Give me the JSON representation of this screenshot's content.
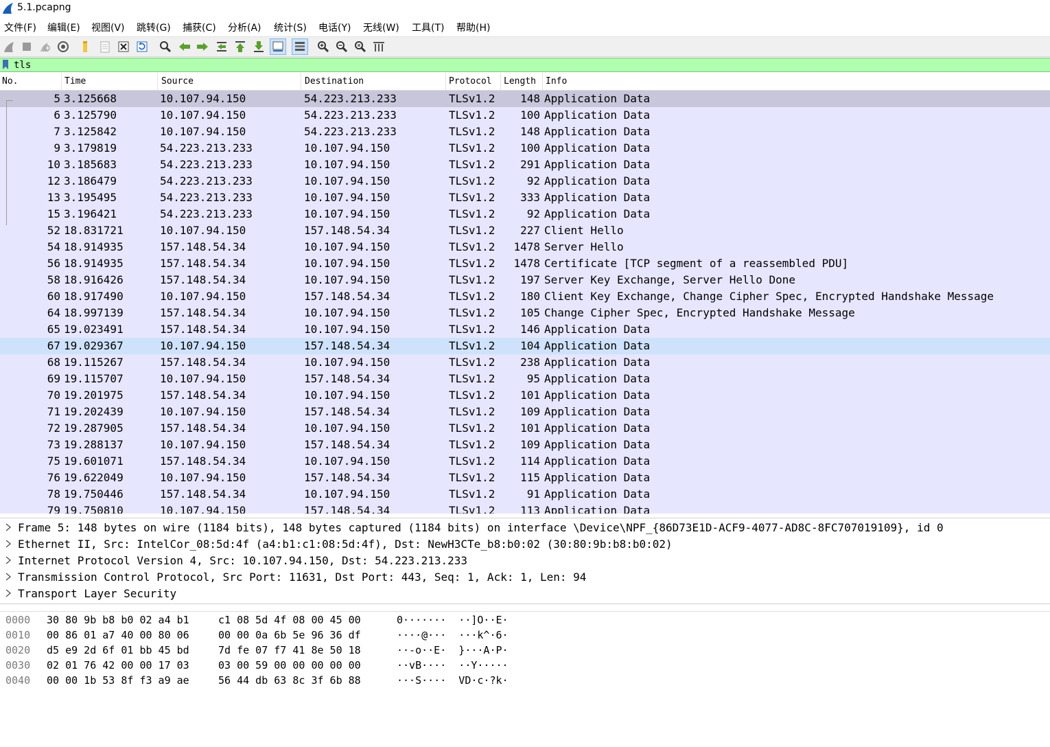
{
  "window": {
    "title": "5.1.pcapng"
  },
  "menu": [
    "文件(F)",
    "编辑(E)",
    "视图(V)",
    "跳转(G)",
    "捕获(C)",
    "分析(A)",
    "统计(S)",
    "电话(Y)",
    "无线(W)",
    "工具(T)",
    "帮助(H)"
  ],
  "filter": {
    "value": "tls"
  },
  "columns": {
    "no": "No.",
    "time": "Time",
    "source": "Source",
    "destination": "Destination",
    "protocol": "Protocol",
    "length": "Length",
    "info": "Info"
  },
  "packets": [
    {
      "no": "5",
      "time": "3.125668",
      "src": "10.107.94.150",
      "dst": "54.223.213.233",
      "proto": "TLSv1.2",
      "len": "148",
      "info": "Application Data"
    },
    {
      "no": "6",
      "time": "3.125790",
      "src": "10.107.94.150",
      "dst": "54.223.213.233",
      "proto": "TLSv1.2",
      "len": "100",
      "info": "Application Data"
    },
    {
      "no": "7",
      "time": "3.125842",
      "src": "10.107.94.150",
      "dst": "54.223.213.233",
      "proto": "TLSv1.2",
      "len": "148",
      "info": "Application Data"
    },
    {
      "no": "9",
      "time": "3.179819",
      "src": "54.223.213.233",
      "dst": "10.107.94.150",
      "proto": "TLSv1.2",
      "len": "100",
      "info": "Application Data"
    },
    {
      "no": "10",
      "time": "3.185683",
      "src": "54.223.213.233",
      "dst": "10.107.94.150",
      "proto": "TLSv1.2",
      "len": "291",
      "info": "Application Data"
    },
    {
      "no": "12",
      "time": "3.186479",
      "src": "54.223.213.233",
      "dst": "10.107.94.150",
      "proto": "TLSv1.2",
      "len": "92",
      "info": "Application Data"
    },
    {
      "no": "13",
      "time": "3.195495",
      "src": "54.223.213.233",
      "dst": "10.107.94.150",
      "proto": "TLSv1.2",
      "len": "333",
      "info": "Application Data"
    },
    {
      "no": "15",
      "time": "3.196421",
      "src": "54.223.213.233",
      "dst": "10.107.94.150",
      "proto": "TLSv1.2",
      "len": "92",
      "info": "Application Data"
    },
    {
      "no": "52",
      "time": "18.831721",
      "src": "10.107.94.150",
      "dst": "157.148.54.34",
      "proto": "TLSv1.2",
      "len": "227",
      "info": "Client Hello"
    },
    {
      "no": "54",
      "time": "18.914935",
      "src": "157.148.54.34",
      "dst": "10.107.94.150",
      "proto": "TLSv1.2",
      "len": "1478",
      "info": "Server Hello"
    },
    {
      "no": "56",
      "time": "18.914935",
      "src": "157.148.54.34",
      "dst": "10.107.94.150",
      "proto": "TLSv1.2",
      "len": "1478",
      "info": "Certificate [TCP segment of a reassembled PDU]"
    },
    {
      "no": "58",
      "time": "18.916426",
      "src": "157.148.54.34",
      "dst": "10.107.94.150",
      "proto": "TLSv1.2",
      "len": "197",
      "info": "Server Key Exchange, Server Hello Done"
    },
    {
      "no": "60",
      "time": "18.917490",
      "src": "10.107.94.150",
      "dst": "157.148.54.34",
      "proto": "TLSv1.2",
      "len": "180",
      "info": "Client Key Exchange, Change Cipher Spec, Encrypted Handshake Message"
    },
    {
      "no": "64",
      "time": "18.997139",
      "src": "157.148.54.34",
      "dst": "10.107.94.150",
      "proto": "TLSv1.2",
      "len": "105",
      "info": "Change Cipher Spec, Encrypted Handshake Message"
    },
    {
      "no": "65",
      "time": "19.023491",
      "src": "157.148.54.34",
      "dst": "10.107.94.150",
      "proto": "TLSv1.2",
      "len": "146",
      "info": "Application Data"
    },
    {
      "no": "67",
      "time": "19.029367",
      "src": "10.107.94.150",
      "dst": "157.148.54.34",
      "proto": "TLSv1.2",
      "len": "104",
      "info": "Application Data"
    },
    {
      "no": "68",
      "time": "19.115267",
      "src": "157.148.54.34",
      "dst": "10.107.94.150",
      "proto": "TLSv1.2",
      "len": "238",
      "info": "Application Data"
    },
    {
      "no": "69",
      "time": "19.115707",
      "src": "10.107.94.150",
      "dst": "157.148.54.34",
      "proto": "TLSv1.2",
      "len": "95",
      "info": "Application Data"
    },
    {
      "no": "70",
      "time": "19.201975",
      "src": "157.148.54.34",
      "dst": "10.107.94.150",
      "proto": "TLSv1.2",
      "len": "101",
      "info": "Application Data"
    },
    {
      "no": "71",
      "time": "19.202439",
      "src": "10.107.94.150",
      "dst": "157.148.54.34",
      "proto": "TLSv1.2",
      "len": "109",
      "info": "Application Data"
    },
    {
      "no": "72",
      "time": "19.287905",
      "src": "157.148.54.34",
      "dst": "10.107.94.150",
      "proto": "TLSv1.2",
      "len": "101",
      "info": "Application Data"
    },
    {
      "no": "73",
      "time": "19.288137",
      "src": "10.107.94.150",
      "dst": "157.148.54.34",
      "proto": "TLSv1.2",
      "len": "109",
      "info": "Application Data"
    },
    {
      "no": "75",
      "time": "19.601071",
      "src": "157.148.54.34",
      "dst": "10.107.94.150",
      "proto": "TLSv1.2",
      "len": "114",
      "info": "Application Data"
    },
    {
      "no": "76",
      "time": "19.622049",
      "src": "10.107.94.150",
      "dst": "157.148.54.34",
      "proto": "TLSv1.2",
      "len": "115",
      "info": "Application Data"
    },
    {
      "no": "78",
      "time": "19.750446",
      "src": "157.148.54.34",
      "dst": "10.107.94.150",
      "proto": "TLSv1.2",
      "len": "91",
      "info": "Application Data"
    },
    {
      "no": "79",
      "time": "19.750810",
      "src": "10.107.94.150",
      "dst": "157.148.54.34",
      "proto": "TLSv1.2",
      "len": "113",
      "info": "Application Data"
    }
  ],
  "selected_packet": "5",
  "hover_packet": "67",
  "details": [
    "Frame 5: 148 bytes on wire (1184 bits), 148 bytes captured (1184 bits) on interface \\Device\\NPF_{86D73E1D-ACF9-4077-AD8C-8FC707019109}, id 0",
    "Ethernet II, Src: IntelCor_08:5d:4f (a4:b1:c1:08:5d:4f), Dst: NewH3CTe_b8:b0:02 (30:80:9b:b8:b0:02)",
    "Internet Protocol Version 4, Src: 10.107.94.150, Dst: 54.223.213.233",
    "Transmission Control Protocol, Src Port: 11631, Dst Port: 443, Seq: 1, Ack: 1, Len: 94",
    "Transport Layer Security"
  ],
  "bytes": [
    {
      "off": "0000",
      "hex1": "30 80 9b b8 b0 02 a4 b1",
      "hex2": "c1 08 5d 4f 08 00 45 00",
      "ascii": "0·······  ··]O··E·"
    },
    {
      "off": "0010",
      "hex1": "00 86 01 a7 40 00 80 06",
      "hex2": "00 00 0a 6b 5e 96 36 df",
      "ascii": "····@···  ···k^·6·"
    },
    {
      "off": "0020",
      "hex1": "d5 e9 2d 6f 01 bb 45 bd",
      "hex2": "7d fe 07 f7 41 8e 50 18",
      "ascii": "··-o··E·  }···A·P·"
    },
    {
      "off": "0030",
      "hex1": "02 01 76 42 00 00 17 03",
      "hex2": "03 00 59 00 00 00 00 00",
      "ascii": "··vB····  ··Y·····"
    },
    {
      "off": "0040",
      "hex1": "00 00 1b 53 8f f3 a9 ae",
      "hex2": "56 44 db 63 8c 3f 6b 88",
      "ascii": "···S····  VD·c·?k·"
    }
  ],
  "colors": {
    "row_bg": "#e7e6ff",
    "row_selected": "#c7c6da",
    "row_hover": "#cfe2fb",
    "filter_ok": "#afffaf",
    "accent": "#1f6fcf"
  },
  "toolbar_icons": [
    "shark-fin-start-icon",
    "stop-icon",
    "restart-icon",
    "capture-options-icon",
    "open-folder-icon",
    "file-icon",
    "close-file-icon",
    "reload-icon",
    "find-icon",
    "go-back-icon",
    "go-forward-icon",
    "go-to-packet-icon",
    "first-packet-icon",
    "last-packet-icon",
    "autoscroll-icon",
    "colorize-icon",
    "zoom-in-icon",
    "zoom-out-icon",
    "normal-size-icon",
    "resize-columns-icon"
  ]
}
